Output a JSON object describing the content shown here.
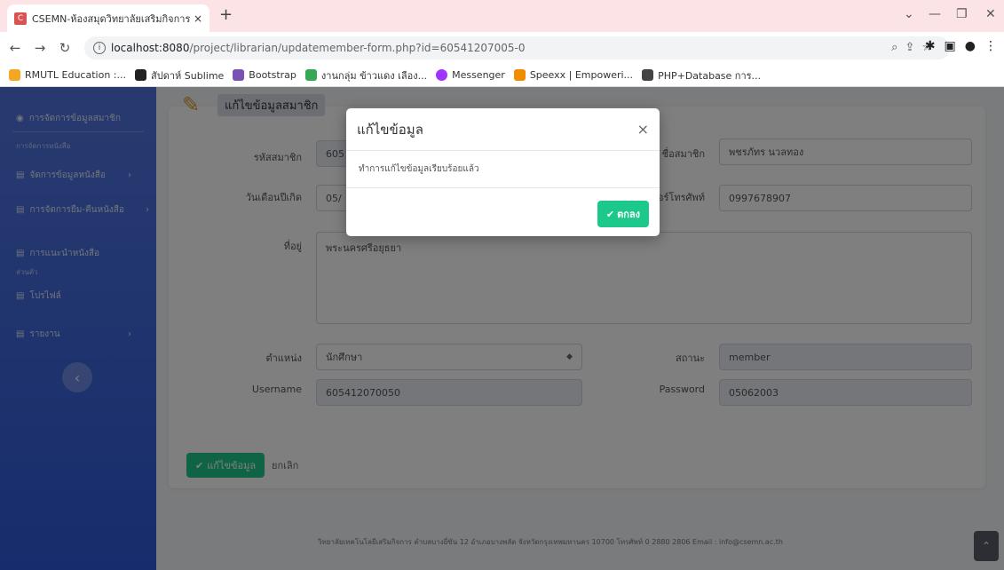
{
  "browser": {
    "tab_title": "CSEMN-ห้องสมุดวิทยาลัยเสริมกิจการ",
    "tab_close": "×",
    "new_tab": "+",
    "url_host": "localhost:8080",
    "url_path": "/project/librarian/updatemember-form.php?id=60541207005-0",
    "bookmarks": [
      {
        "label": "RMUTL Education :...",
        "color": "#f5a623"
      },
      {
        "label": "สัปดาห์ Sublime",
        "color": "#222222"
      },
      {
        "label": "Bootstrap",
        "color": "#7952b3"
      },
      {
        "label": "งานกลุ่ม ข้าวแดง เลือง...",
        "color": "#34a853"
      },
      {
        "label": "Messenger",
        "color": "#a033ff"
      },
      {
        "label": "Speexx | Empoweri...",
        "color": "#f28b00"
      },
      {
        "label": "PHP+Database การ...",
        "color": "#444444"
      }
    ]
  },
  "sidebar": {
    "items": [
      {
        "label": "การจัดการข้อมูลสมาชิก",
        "icon": "gauge-icon"
      },
      {
        "label": "จัดการข้อมูลหนังสือ",
        "icon": "book-icon"
      },
      {
        "label": "การจัดการยืม-คืนหนังสือ",
        "icon": "swap-icon"
      },
      {
        "label": "การแนะนำหนังสือ",
        "icon": "star-icon"
      },
      {
        "label": "โปรไฟล์",
        "icon": "user-icon"
      },
      {
        "label": "รายงาน",
        "icon": "report-icon"
      }
    ],
    "heading1": "การจัดการหนังสือ",
    "heading2": "ส่วนตัว",
    "toggle": "‹"
  },
  "form": {
    "header": "แก้ไขข้อมูลสมาชิก",
    "member_id_label": "รหัสสมาชิก",
    "member_id_value": "605",
    "member_name_label": "ชื่อสมาชิก",
    "member_name_value": "พชรภัทร นวลทอง",
    "birth_label": "วันเดือนปีเกิด",
    "birth_value": "05/",
    "phone_label": "เบอร์โทรศัพท์",
    "phone_value": "0997678907",
    "address_label": "ที่อยู่",
    "address_value": "พระนครศรีอยุธยา",
    "position_label": "ตำแหน่ง",
    "position_value": "นักศึกษา",
    "status_label": "สถานะ",
    "status_value": "member",
    "username_label": "Username",
    "username_value": "605412070050",
    "password_label": "Password",
    "password_value": "05062003",
    "edit_button": "แก้ไขข้อมูล",
    "cancel_button": "ยกเลิก"
  },
  "footer": {
    "text": "วิทยาลัยเทคโนโลยีเสริมกิจการ ตำบลบางยี่ขัน 12 อำเภอบางพลัด จังหวัดกรุงเทพมหานคร 10700 โทรศัพท์ 0 2880 2806 Email : info@csemn.ac.th"
  },
  "modal": {
    "title": "แก้ไขข้อมูล",
    "close": "×",
    "message": "ทำการแก้ไขข้อมูลเรียบร้อยแล้ว",
    "ok_button": "ตกลง"
  }
}
